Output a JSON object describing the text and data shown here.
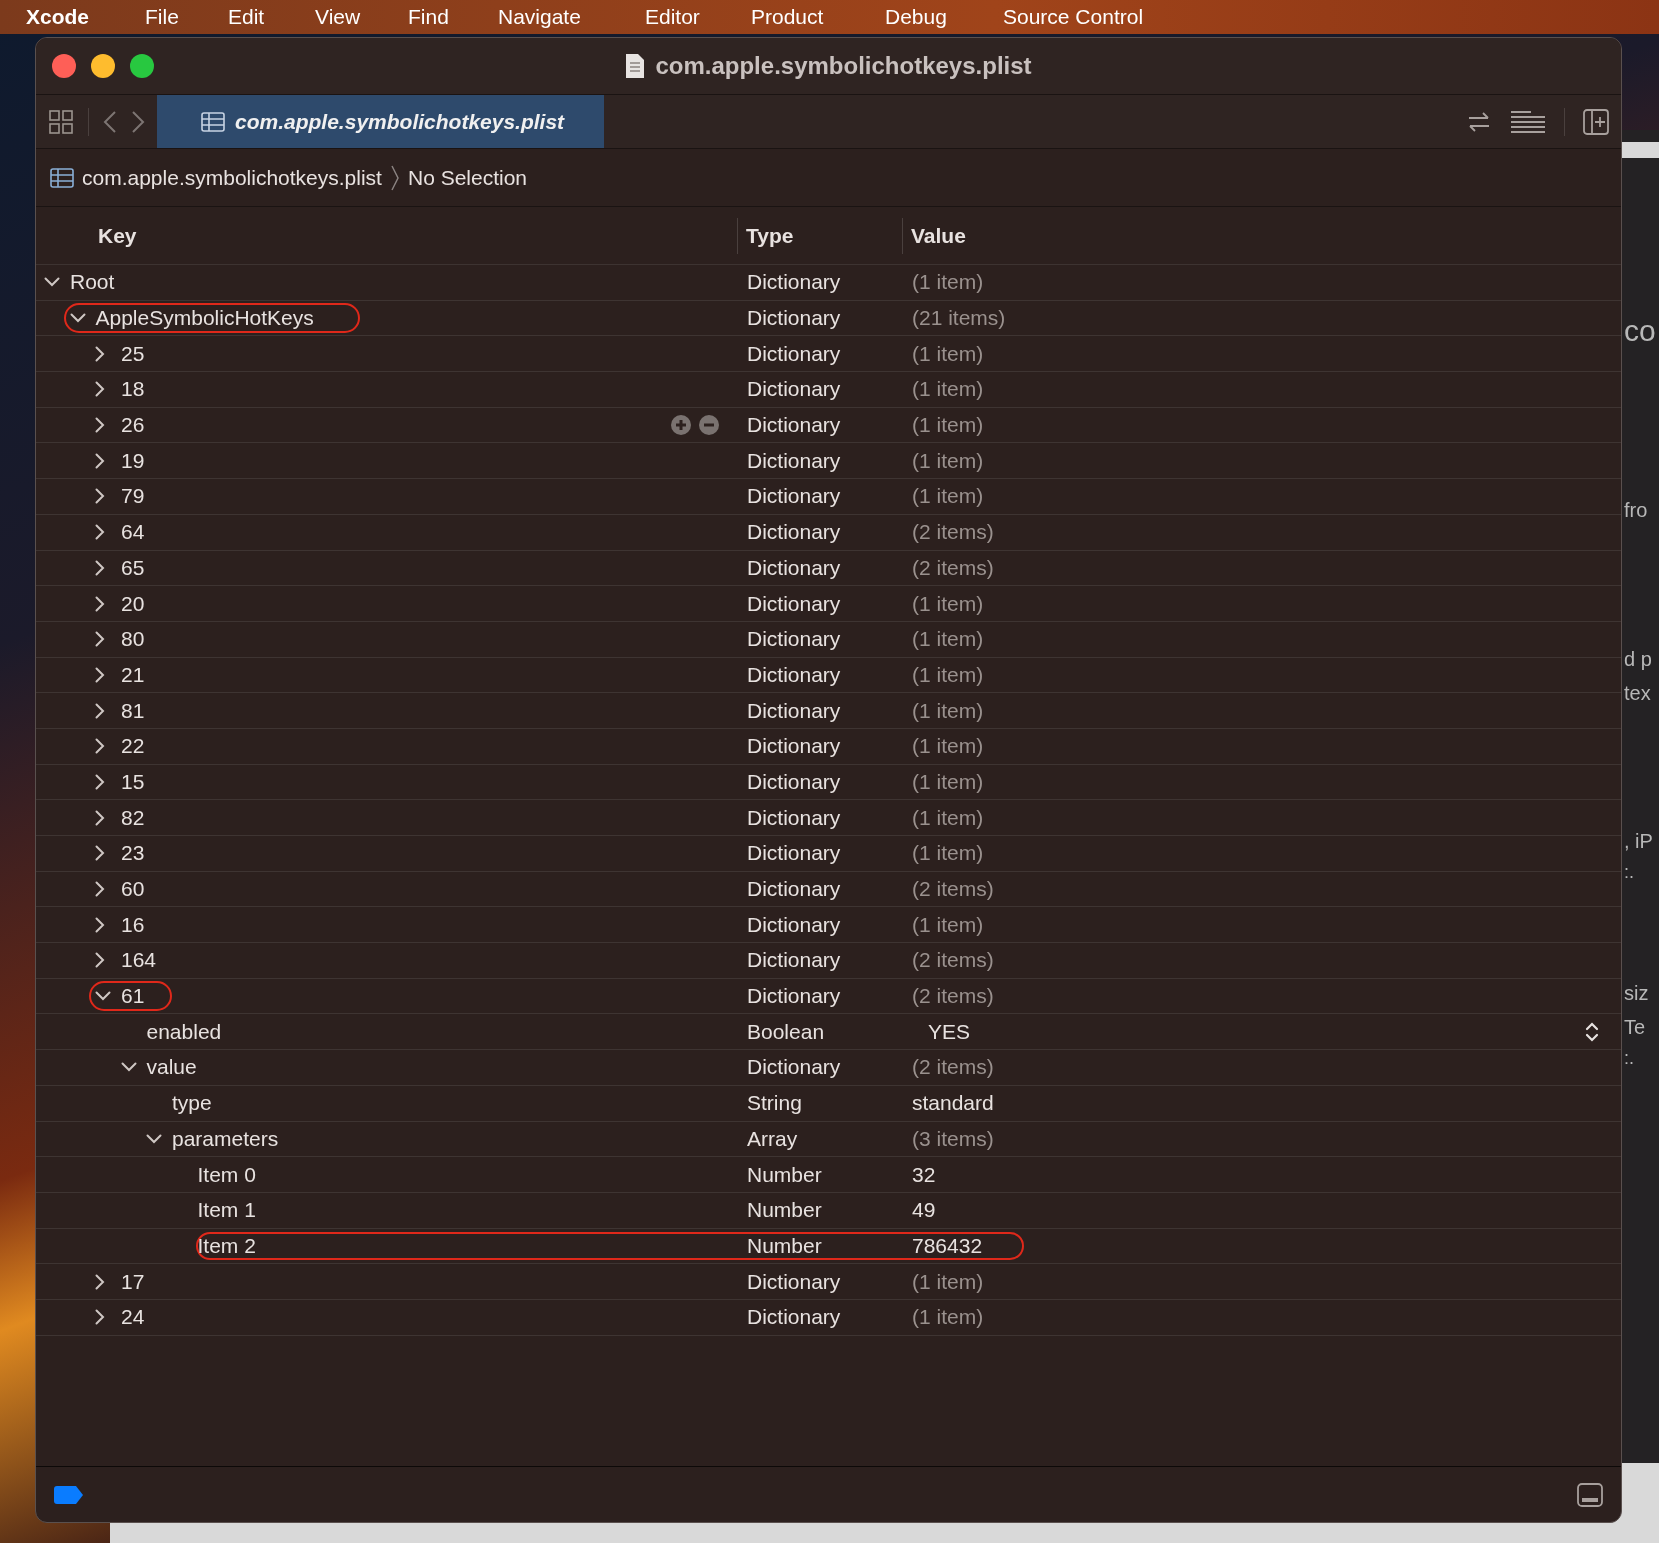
{
  "menu_bar": {
    "items": [
      "Xcode",
      "File",
      "Edit",
      "View",
      "Find",
      "Navigate",
      "Editor",
      "Product",
      "Debug",
      "Source Control"
    ]
  },
  "window": {
    "title": "com.apple.symbolichotkeys.plist"
  },
  "tabs": [
    {
      "label": "com.apple.symbolichotkeys.plist",
      "selected": true
    }
  ],
  "breadcrumb": [
    "com.apple.symbolichotkeys.plist",
    "No Selection"
  ],
  "table": {
    "columns": [
      "Key",
      "Type",
      "Value"
    ],
    "rows": [
      {
        "key": "Root",
        "type": "Dictionary",
        "value": "(1 item)",
        "muted": true,
        "expanded": true,
        "children": [
          {
            "key": "AppleSymbolicHotKeys",
            "type": "Dictionary",
            "value": "(21 items)",
            "muted": true,
            "expanded": true,
            "circled": true,
            "children": [
              {
                "key": "25",
                "type": "Dictionary",
                "value": "(1 item)",
                "muted": true,
                "expanded": false
              },
              {
                "key": "18",
                "type": "Dictionary",
                "value": "(1 item)",
                "muted": true,
                "expanded": false
              },
              {
                "key": "26",
                "type": "Dictionary",
                "value": "(1 item)",
                "muted": true,
                "expanded": false,
                "hover": true
              },
              {
                "key": "19",
                "type": "Dictionary",
                "value": "(1 item)",
                "muted": true,
                "expanded": false
              },
              {
                "key": "79",
                "type": "Dictionary",
                "value": "(1 item)",
                "muted": true,
                "expanded": false
              },
              {
                "key": "64",
                "type": "Dictionary",
                "value": "(2 items)",
                "muted": true,
                "expanded": false
              },
              {
                "key": "65",
                "type": "Dictionary",
                "value": "(2 items)",
                "muted": true,
                "expanded": false
              },
              {
                "key": "20",
                "type": "Dictionary",
                "value": "(1 item)",
                "muted": true,
                "expanded": false
              },
              {
                "key": "80",
                "type": "Dictionary",
                "value": "(1 item)",
                "muted": true,
                "expanded": false
              },
              {
                "key": "21",
                "type": "Dictionary",
                "value": "(1 item)",
                "muted": true,
                "expanded": false
              },
              {
                "key": "81",
                "type": "Dictionary",
                "value": "(1 item)",
                "muted": true,
                "expanded": false
              },
              {
                "key": "22",
                "type": "Dictionary",
                "value": "(1 item)",
                "muted": true,
                "expanded": false
              },
              {
                "key": "15",
                "type": "Dictionary",
                "value": "(1 item)",
                "muted": true,
                "expanded": false
              },
              {
                "key": "82",
                "type": "Dictionary",
                "value": "(1 item)",
                "muted": true,
                "expanded": false
              },
              {
                "key": "23",
                "type": "Dictionary",
                "value": "(1 item)",
                "muted": true,
                "expanded": false
              },
              {
                "key": "60",
                "type": "Dictionary",
                "value": "(2 items)",
                "muted": true,
                "expanded": false
              },
              {
                "key": "16",
                "type": "Dictionary",
                "value": "(1 item)",
                "muted": true,
                "expanded": false
              },
              {
                "key": "164",
                "type": "Dictionary",
                "value": "(2 items)",
                "muted": true,
                "expanded": false
              },
              {
                "key": "61",
                "type": "Dictionary",
                "value": "(2 items)",
                "muted": true,
                "expanded": true,
                "circled": true,
                "children": [
                  {
                    "key": "enabled",
                    "type": "Boolean",
                    "value": "YES",
                    "muted": false,
                    "popup": true
                  },
                  {
                    "key": "value",
                    "type": "Dictionary",
                    "value": "(2 items)",
                    "muted": true,
                    "expanded": true,
                    "children": [
                      {
                        "key": "type",
                        "type": "String",
                        "value": "standard",
                        "muted": false
                      },
                      {
                        "key": "parameters",
                        "type": "Array",
                        "value": "(3 items)",
                        "muted": true,
                        "expanded": true,
                        "children": [
                          {
                            "key": "Item 0",
                            "type": "Number",
                            "value": "32",
                            "muted": false
                          },
                          {
                            "key": "Item 1",
                            "type": "Number",
                            "value": "49",
                            "muted": false
                          },
                          {
                            "key": "Item 2",
                            "type": "Number",
                            "value": "786432",
                            "muted": false,
                            "row_circled": true
                          }
                        ]
                      }
                    ]
                  }
                ]
              },
              {
                "key": "17",
                "type": "Dictionary",
                "value": "(1 item)",
                "muted": true,
                "expanded": false
              },
              {
                "key": "24",
                "type": "Dictionary",
                "value": "(1 item)",
                "muted": true,
                "expanded": false
              }
            ]
          }
        ]
      }
    ]
  },
  "background_window": {
    "fragments": [
      "co",
      "fro",
      "d p",
      "tex",
      ", iP",
      ":.",
      "siz",
      "Te",
      ":."
    ]
  }
}
